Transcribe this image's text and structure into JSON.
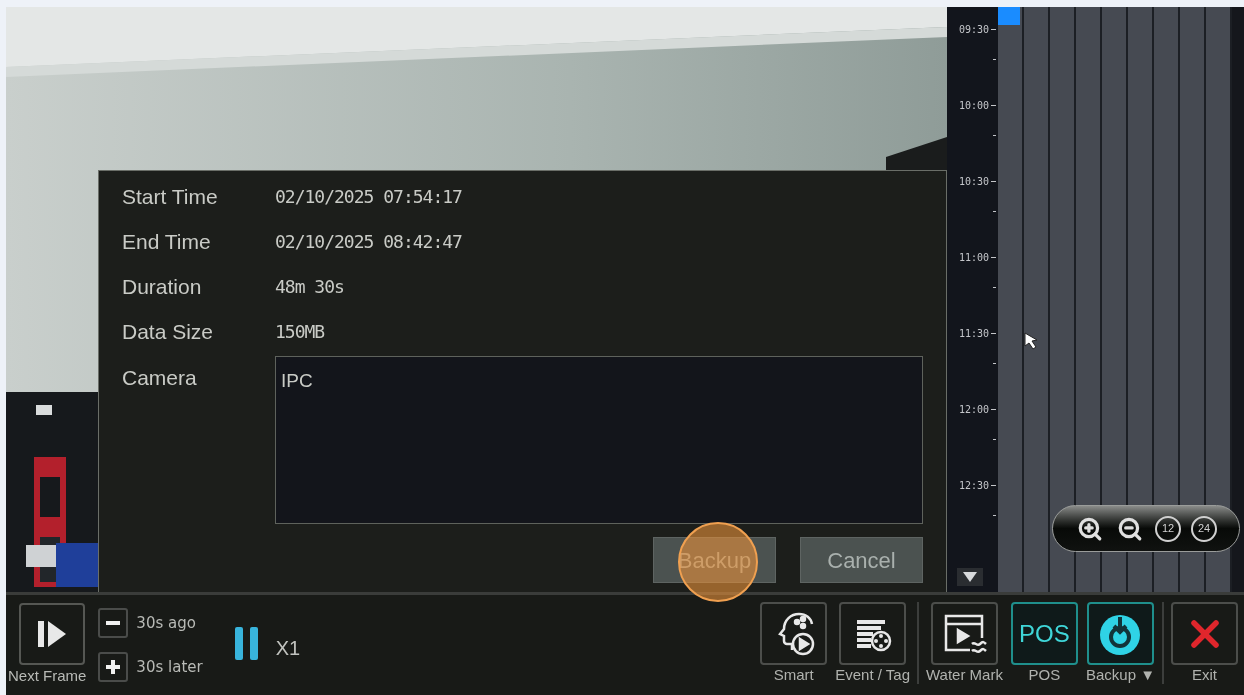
{
  "dialog": {
    "fields": [
      {
        "label": "Start Time",
        "value": "02/10/2025 07:54:17"
      },
      {
        "label": "End Time",
        "value": "02/10/2025 08:42:47"
      },
      {
        "label": "Duration",
        "value": "48m 30s"
      },
      {
        "label": "Data Size",
        "value": "150MB"
      }
    ],
    "camera": {
      "label": "Camera",
      "value": "IPC"
    },
    "buttons": [
      "Backup",
      "Cancel"
    ]
  },
  "timeline": {
    "times": [
      "09:30",
      "10:00",
      "10:30",
      "11:00",
      "11:30",
      "12:00",
      "12:30"
    ],
    "zoom_buttons": [
      "12",
      "24"
    ]
  },
  "playback": {
    "next_frame": "Next Frame",
    "skip": [
      {
        "kind": "back",
        "label": "30s ago"
      },
      {
        "kind": "forward",
        "label": "30s later"
      }
    ],
    "speed": "X1"
  },
  "toolbar": [
    {
      "kind": "smart",
      "label": "Smart",
      "highlighted": false
    },
    {
      "kind": "event",
      "label": "Event / Tag",
      "highlighted": false
    },
    {
      "kind": "watermark",
      "label": "Water Mark",
      "highlighted": false
    },
    {
      "kind": "pos",
      "label": "POS",
      "icon_text": "POS",
      "highlighted": true
    },
    {
      "kind": "backup",
      "label": "Backup ▼",
      "highlighted": true
    },
    {
      "kind": "exit",
      "label": "Exit",
      "highlighted": false
    }
  ]
}
